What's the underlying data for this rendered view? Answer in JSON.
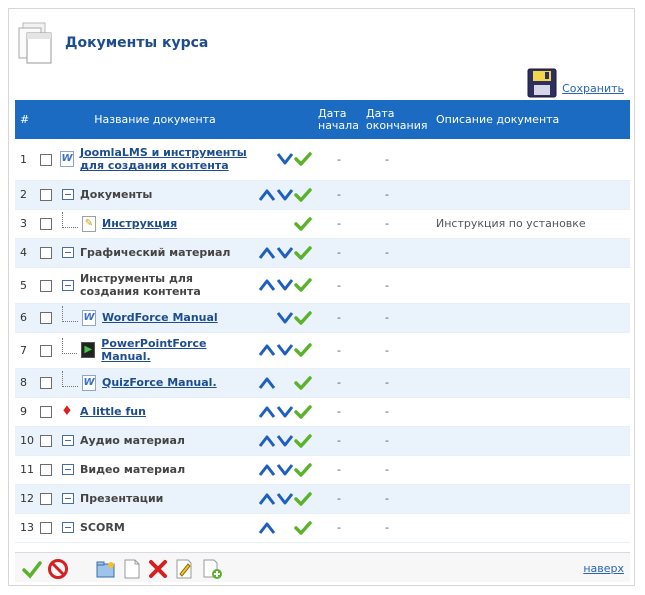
{
  "header": {
    "title": "Документы курса",
    "save_label": "Сохранить"
  },
  "columns": {
    "num": "#",
    "name": "Название документа",
    "start": "Дата начала",
    "end": "Дата окончания",
    "desc": "Описание документа"
  },
  "rows": [
    {
      "num": "1",
      "name": "JoomlaLMS и инструменты для создания контента",
      "kind": "doc",
      "icon": "word-doc-icon",
      "indent": false,
      "up": false,
      "down": true,
      "start": "-",
      "end": "-",
      "desc": ""
    },
    {
      "num": "2",
      "name": "Документы",
      "kind": "folder",
      "indent": false,
      "up": true,
      "down": true,
      "start": "-",
      "end": "-",
      "desc": ""
    },
    {
      "num": "3",
      "name": "Инструкция",
      "kind": "doc",
      "icon": "edit-doc-icon",
      "indent": true,
      "up": false,
      "down": false,
      "start": "-",
      "end": "-",
      "desc": "Инструкция по установке"
    },
    {
      "num": "4",
      "name": "Графический материал",
      "kind": "folder",
      "indent": false,
      "up": true,
      "down": true,
      "start": "-",
      "end": "-",
      "desc": ""
    },
    {
      "num": "5",
      "name": "Инструменты для создания контента",
      "kind": "folder",
      "indent": false,
      "up": true,
      "down": true,
      "start": "-",
      "end": "-",
      "desc": ""
    },
    {
      "num": "6",
      "name": "WordForce Manual",
      "kind": "doc",
      "icon": "word-doc-icon",
      "indent": true,
      "up": false,
      "down": true,
      "start": "-",
      "end": "-",
      "desc": ""
    },
    {
      "num": "7",
      "name": "PowerPointForce Manual.",
      "kind": "doc",
      "icon": "ppt-doc-icon",
      "indent": true,
      "up": true,
      "down": true,
      "start": "-",
      "end": "-",
      "desc": ""
    },
    {
      "num": "8",
      "name": "QuizForce Manual.",
      "kind": "doc",
      "icon": "word-doc-icon",
      "indent": true,
      "up": true,
      "down": false,
      "start": "-",
      "end": "-",
      "desc": ""
    },
    {
      "num": "9",
      "name": "A little fun",
      "kind": "doc",
      "icon": "pdf-doc-icon",
      "indent": false,
      "up": true,
      "down": true,
      "start": "-",
      "end": "-",
      "desc": ""
    },
    {
      "num": "10",
      "name": "Аудио материал",
      "kind": "folder",
      "indent": false,
      "up": true,
      "down": true,
      "start": "-",
      "end": "-",
      "desc": ""
    },
    {
      "num": "11",
      "name": "Видео материал",
      "kind": "folder",
      "indent": false,
      "up": true,
      "down": true,
      "start": "-",
      "end": "-",
      "desc": ""
    },
    {
      "num": "12",
      "name": "Презентации",
      "kind": "folder",
      "indent": false,
      "up": true,
      "down": true,
      "start": "-",
      "end": "-",
      "desc": ""
    },
    {
      "num": "13",
      "name": "SCORM",
      "kind": "folder",
      "indent": false,
      "up": true,
      "down": false,
      "start": "-",
      "end": "-",
      "desc": ""
    }
  ],
  "footer": {
    "tools": [
      "publish-icon",
      "unpublish-icon",
      "new-folder-icon",
      "new-document-icon",
      "delete-icon",
      "edit-icon",
      "add-link-icon"
    ],
    "top_label": "наверх"
  },
  "colors": {
    "accent": "#1a6bc1",
    "title": "#1d4d8f",
    "alt_row": "#eaf3fb",
    "ok": "#5cb22b"
  }
}
